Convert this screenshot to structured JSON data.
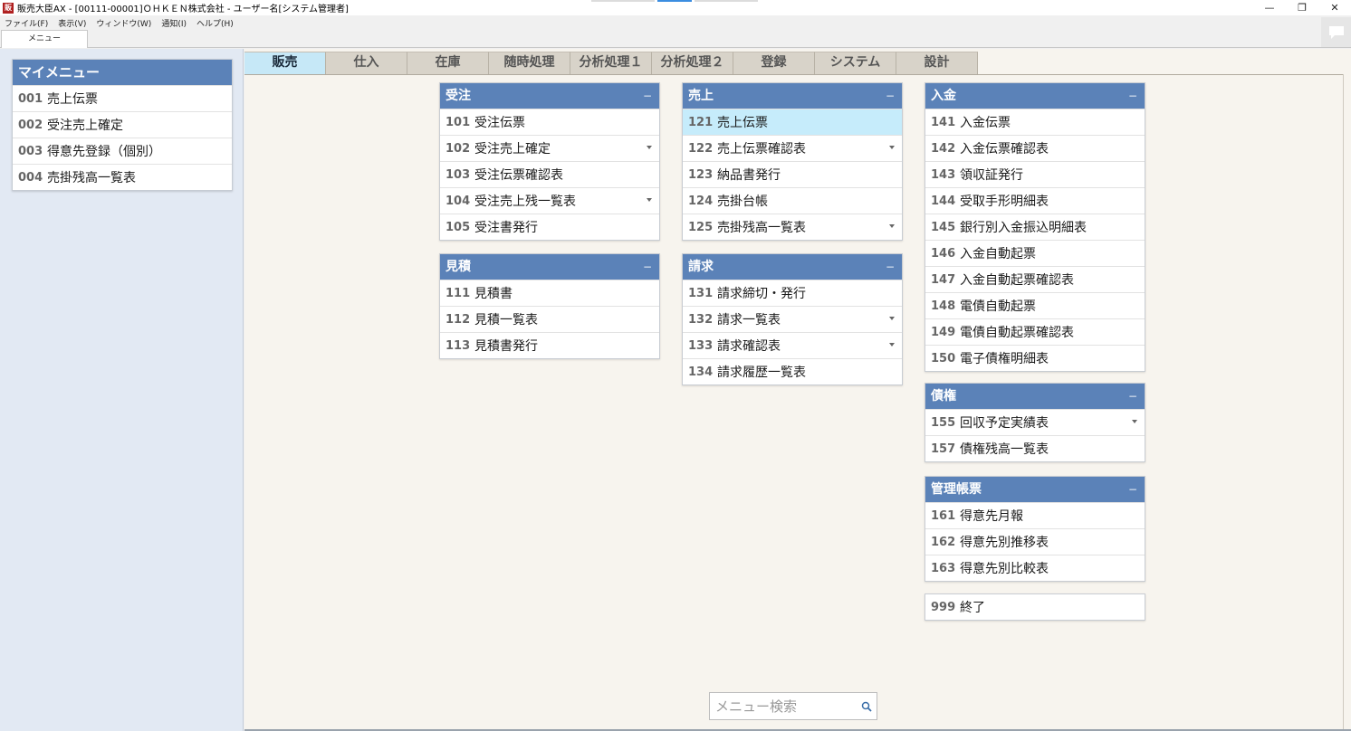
{
  "window": {
    "app_icon_text": "販",
    "title": "販売大臣AX - [00111-00001]ＯＨＫＥＮ株式会社 - ユーザー名[システム管理者]",
    "controls": {
      "minimize": "—",
      "restore": "❐",
      "close": "✕"
    }
  },
  "menubar": [
    "ファイル(F)",
    "表示(V)",
    "ウィンドウ(W)",
    "通知(I)",
    "ヘルプ(H)"
  ],
  "doc_tab": "メニュー",
  "sidebar": {
    "title": "マイメニュー",
    "items": [
      {
        "code": "001",
        "label": "売上伝票"
      },
      {
        "code": "002",
        "label": "受注売上確定"
      },
      {
        "code": "003",
        "label": "得意先登録（個別）"
      },
      {
        "code": "004",
        "label": "売掛残高一覧表"
      }
    ]
  },
  "tabs": [
    {
      "label": "販売",
      "active": true
    },
    {
      "label": "仕入"
    },
    {
      "label": "在庫"
    },
    {
      "label": "随時処理"
    },
    {
      "label": "分析処理１"
    },
    {
      "label": "分析処理２"
    },
    {
      "label": "登録"
    },
    {
      "label": "システム"
    },
    {
      "label": "設計"
    }
  ],
  "panels": {
    "juchu": {
      "title": "受注",
      "collapse": "−",
      "items": [
        {
          "code": "101",
          "label": "受注伝票"
        },
        {
          "code": "102",
          "label": "受注売上確定",
          "dropdown": true
        },
        {
          "code": "103",
          "label": "受注伝票確認表"
        },
        {
          "code": "104",
          "label": "受注売上残一覧表",
          "dropdown": true
        },
        {
          "code": "105",
          "label": "受注書発行"
        }
      ]
    },
    "mitsumori": {
      "title": "見積",
      "collapse": "−",
      "items": [
        {
          "code": "111",
          "label": "見積書"
        },
        {
          "code": "112",
          "label": "見積一覧表"
        },
        {
          "code": "113",
          "label": "見積書発行"
        }
      ]
    },
    "uriage": {
      "title": "売上",
      "collapse": "−",
      "items": [
        {
          "code": "121",
          "label": "売上伝票",
          "highlight": true
        },
        {
          "code": "122",
          "label": "売上伝票確認表",
          "dropdown": true
        },
        {
          "code": "123",
          "label": "納品書発行"
        },
        {
          "code": "124",
          "label": "売掛台帳"
        },
        {
          "code": "125",
          "label": "売掛残高一覧表",
          "dropdown": true
        }
      ]
    },
    "seikyu": {
      "title": "請求",
      "collapse": "−",
      "items": [
        {
          "code": "131",
          "label": "請求締切・発行"
        },
        {
          "code": "132",
          "label": "請求一覧表",
          "dropdown": true
        },
        {
          "code": "133",
          "label": "請求確認表",
          "dropdown": true
        },
        {
          "code": "134",
          "label": "請求履歴一覧表"
        }
      ]
    },
    "nyukin": {
      "title": "入金",
      "collapse": "−",
      "items": [
        {
          "code": "141",
          "label": "入金伝票"
        },
        {
          "code": "142",
          "label": "入金伝票確認表"
        },
        {
          "code": "143",
          "label": "領収証発行"
        },
        {
          "code": "144",
          "label": "受取手形明細表"
        },
        {
          "code": "145",
          "label": "銀行別入金振込明細表"
        },
        {
          "code": "146",
          "label": "入金自動起票"
        },
        {
          "code": "147",
          "label": "入金自動起票確認表"
        },
        {
          "code": "148",
          "label": "電債自動起票"
        },
        {
          "code": "149",
          "label": "電債自動起票確認表"
        },
        {
          "code": "150",
          "label": "電子債権明細表"
        }
      ]
    },
    "saiken": {
      "title": "債権",
      "collapse": "−",
      "items": [
        {
          "code": "155",
          "label": "回収予定実績表",
          "dropdown": true
        },
        {
          "code": "157",
          "label": "債権残高一覧表"
        }
      ]
    },
    "kanri": {
      "title": "管理帳票",
      "collapse": "−",
      "items": [
        {
          "code": "161",
          "label": "得意先月報"
        },
        {
          "code": "162",
          "label": "得意先別推移表"
        },
        {
          "code": "163",
          "label": "得意先別比較表"
        }
      ]
    }
  },
  "exit": {
    "code": "999",
    "label": "終了"
  },
  "search": {
    "placeholder": "メニュー検索"
  },
  "colors": {
    "panel_header": "#5b82b8",
    "active_tab": "#c6e8f7",
    "highlight_row": "#c6ecfb"
  }
}
